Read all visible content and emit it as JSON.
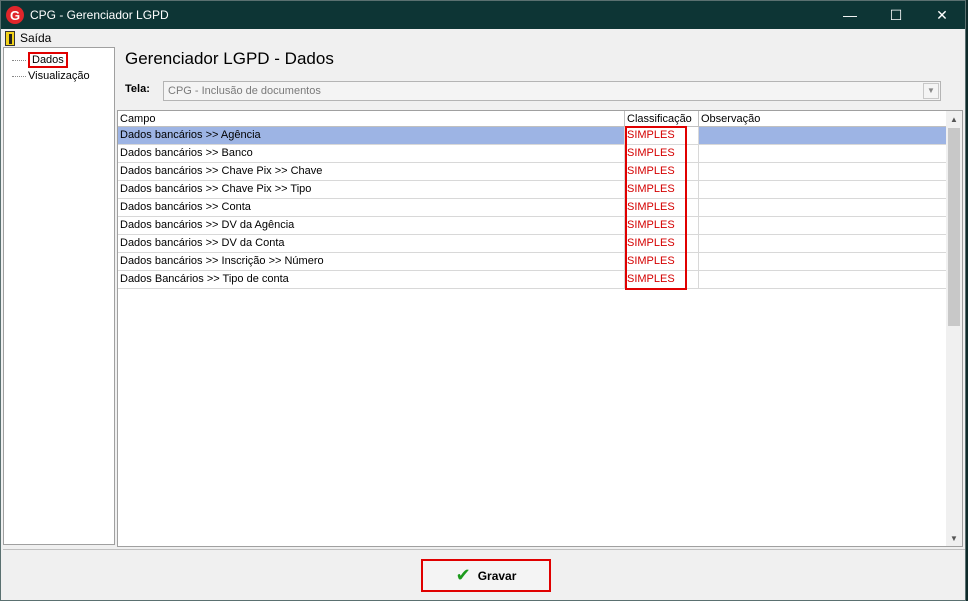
{
  "window": {
    "title": "CPG - Gerenciador LGPD",
    "app_icon": "G",
    "controls": {
      "minimize": "—",
      "maximize": "☐",
      "close": "✕"
    }
  },
  "menu": {
    "exit_label": "Saída",
    "exit_icon": "exit-door-icon"
  },
  "tree": {
    "items": [
      "Dados",
      "Visualização"
    ]
  },
  "main": {
    "heading": "Gerenciador LGPD - Dados",
    "tela_label": "Tela:",
    "tela_value": "CPG - Inclusão de documentos"
  },
  "grid": {
    "columns": [
      "Campo",
      "Classificação",
      "Observação"
    ],
    "rows": [
      {
        "campo": "Dados bancários >> Agência",
        "classificacao": "SIMPLES",
        "observacao": ""
      },
      {
        "campo": "Dados bancários >> Banco",
        "classificacao": "SIMPLES",
        "observacao": ""
      },
      {
        "campo": "Dados bancários >> Chave Pix >> Chave",
        "classificacao": "SIMPLES",
        "observacao": ""
      },
      {
        "campo": "Dados bancários >> Chave Pix >> Tipo",
        "classificacao": "SIMPLES",
        "observacao": ""
      },
      {
        "campo": "Dados bancários >> Conta",
        "classificacao": "SIMPLES",
        "observacao": ""
      },
      {
        "campo": "Dados bancários >> DV da Agência",
        "classificacao": "SIMPLES",
        "observacao": ""
      },
      {
        "campo": "Dados bancários >> DV da Conta",
        "classificacao": "SIMPLES",
        "observacao": ""
      },
      {
        "campo": "Dados bancários >> Inscrição >> Número",
        "classificacao": "SIMPLES",
        "observacao": ""
      },
      {
        "campo": "Dados Bancários >> Tipo de conta",
        "classificacao": "SIMPLES",
        "observacao": ""
      }
    ]
  },
  "footer": {
    "save_label": "Gravar",
    "save_icon": "check-icon"
  },
  "colors": {
    "titlebar": "#0d3535",
    "classification_text": "#d40000",
    "selected_row": "#9db4e4",
    "highlight": "#e00000"
  }
}
